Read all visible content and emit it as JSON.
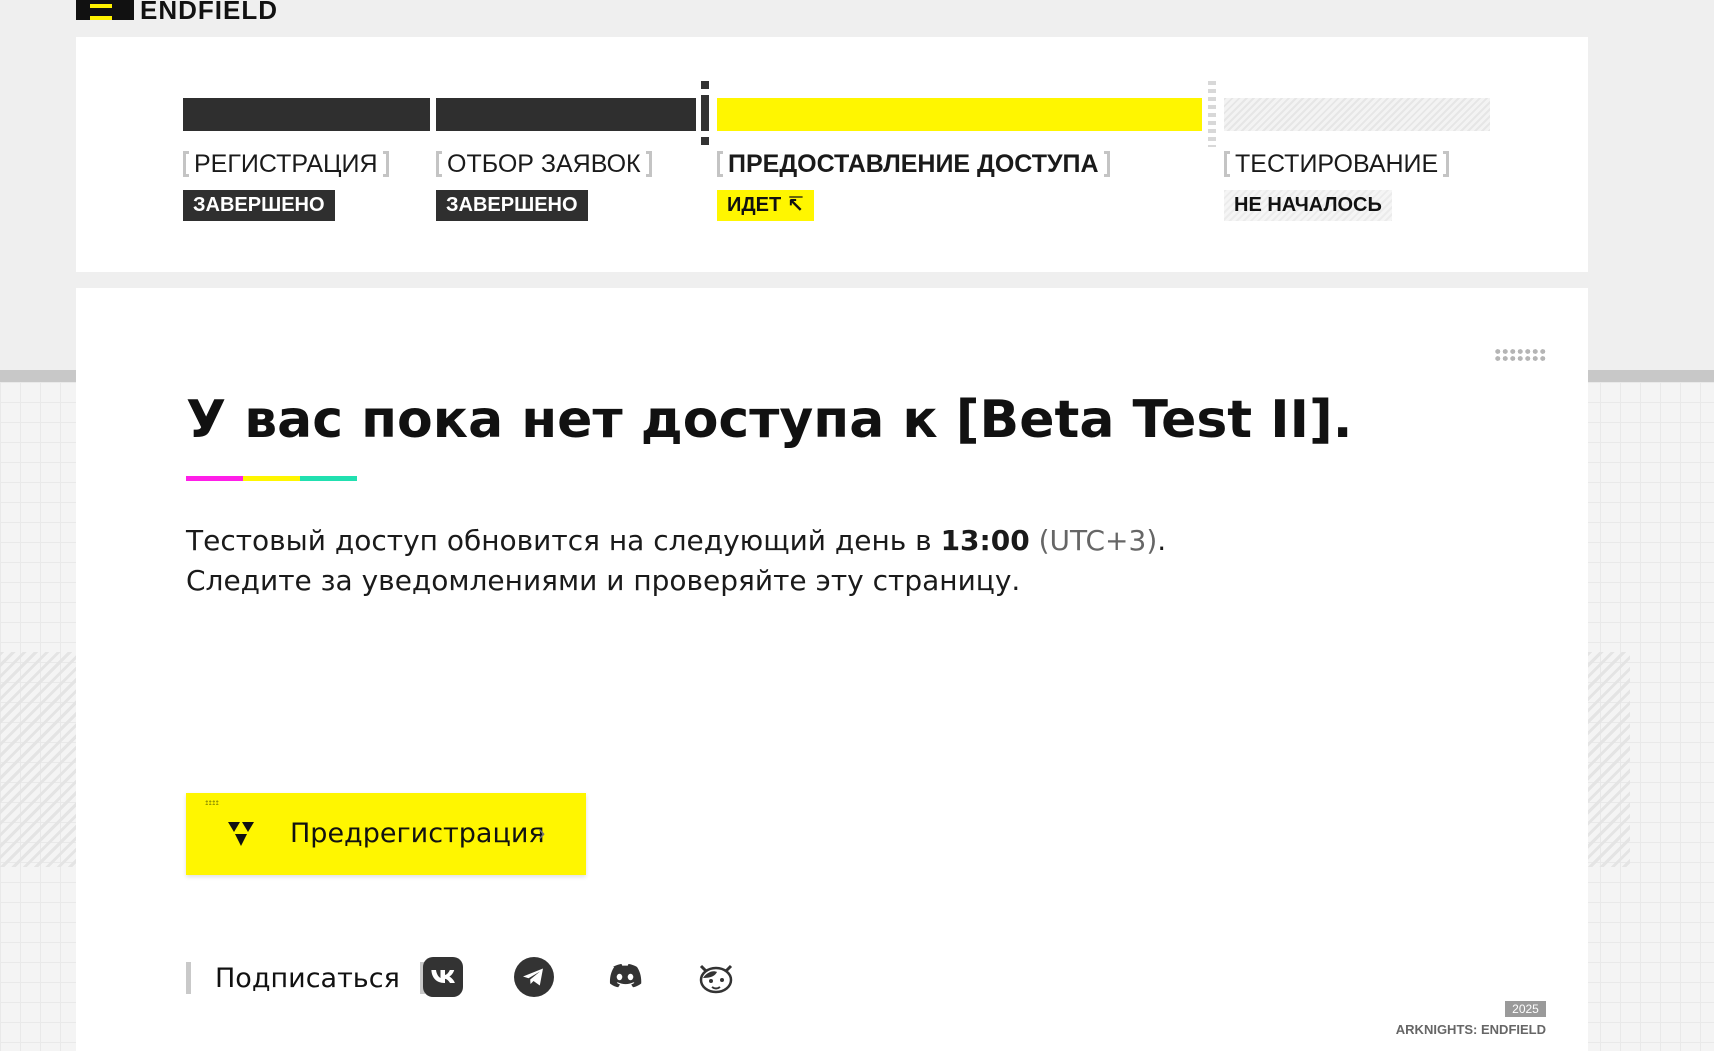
{
  "header": {
    "logo_text": "ENDFIELD"
  },
  "progress": {
    "stages": [
      {
        "label": "РЕГИСТРАЦИЯ",
        "status": "ЗАВЕРШЕНО",
        "state": "done"
      },
      {
        "label": "ОТБОР ЗАЯВОК",
        "status": "ЗАВЕРШЕНО",
        "state": "done"
      },
      {
        "label": "ПРЕДОСТАВЛЕНИЕ ДОСТУПА",
        "status": "ИДЕТ ↸",
        "state": "active"
      },
      {
        "label": "ТЕСТИРОВАНИЕ",
        "status": "НЕ НАЧАЛОСЬ",
        "state": "pending"
      }
    ]
  },
  "main": {
    "headline": "У вас пока нет доступа к [Beta Test II].",
    "underline_colors": [
      "#ff1ee8",
      "#fff600",
      "#21e0b0"
    ],
    "desc_line1_prefix": "Тестовый доступ обновится на следующий день в ",
    "desc_time": "13:00",
    "desc_tz": " (UTC+3)",
    "desc_line1_suffix": ".",
    "desc_line2": "Следите за уведомлениями и проверяйте эту страницу.",
    "prereg_label": "Предрегистрация",
    "prereg_chevron": "›",
    "subscribe_label": "Подписаться",
    "social": [
      {
        "name": "vk",
        "icon": "vk-icon"
      },
      {
        "name": "telegram",
        "icon": "telegram-icon"
      },
      {
        "name": "discord",
        "icon": "discord-icon"
      },
      {
        "name": "mascot",
        "icon": "mascot-icon"
      }
    ]
  },
  "footer": {
    "year": "2025",
    "brand": "ARKNIGHTS: ENDFIELD"
  },
  "colors": {
    "accent_yellow": "#fff600",
    "dark": "#2f2f2f"
  }
}
